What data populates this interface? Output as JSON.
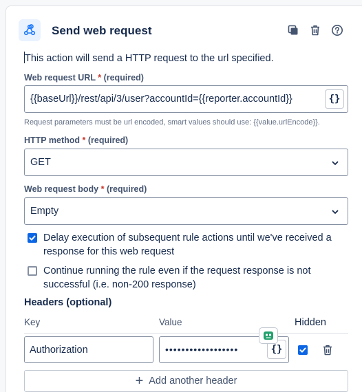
{
  "header": {
    "title": "Send web request",
    "icons": [
      "webhook-icon",
      "duplicate-icon",
      "delete-icon",
      "help-icon"
    ]
  },
  "description": "This action will send a HTTP request to the url specified.",
  "url_field": {
    "label": "Web request URL",
    "required_marker": "*",
    "required_text": "(required)",
    "value": "{{baseUrl}}/rest/api/3/user?accountId={{reporter.accountId}}",
    "smart_value_button": "{}",
    "help": "Request parameters must be url encoded, smart values should use: {{value.urlEncode}}."
  },
  "method_field": {
    "label": "HTTP method",
    "required_marker": "*",
    "required_text": "(required)",
    "value": "GET"
  },
  "body_field": {
    "label": "Web request body",
    "required_marker": "*",
    "required_text": "(required)",
    "value": "Empty"
  },
  "options": [
    {
      "text": "Delay execution of subsequent rule actions until we've received a response for this web request",
      "checked": true
    },
    {
      "text": "Continue running the rule even if the request response is not successful (i.e. non-200 response)",
      "checked": false
    }
  ],
  "headers": {
    "title": "Headers (optional)",
    "columns": {
      "key": "Key",
      "value": "Value",
      "hidden": "Hidden"
    },
    "rows": [
      {
        "key": "Authorization",
        "value_masked": "••••••••••••••••••",
        "smart_value_button": "{}",
        "hidden": true
      }
    ],
    "add_label": "Add another header"
  },
  "colors": {
    "accent": "#0c66e4",
    "required": "#c9372c",
    "text": "#172b4d",
    "subtle": "#44546f"
  }
}
